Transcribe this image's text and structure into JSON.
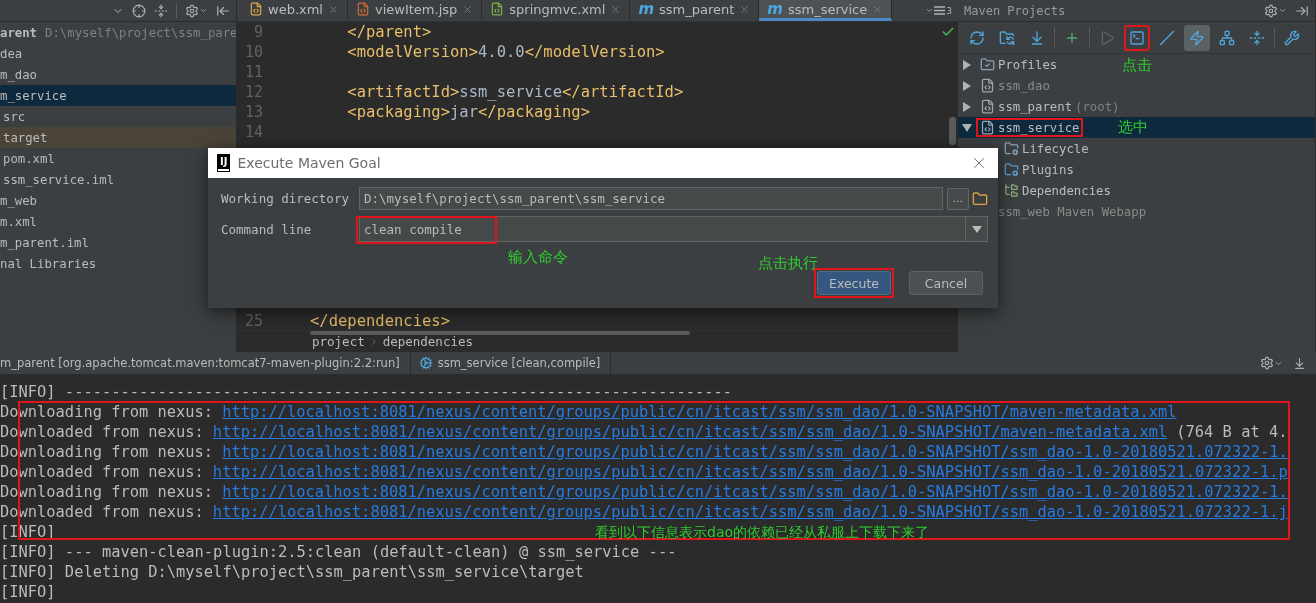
{
  "project_panel": {
    "rows": [
      {
        "label": "arent",
        "detail": "D:\\myself\\project\\ssm_pare",
        "selected": false,
        "excluded": false
      },
      {
        "label": "dea",
        "selected": false,
        "excluded": false
      },
      {
        "label": "m_dao",
        "selected": false,
        "excluded": false
      },
      {
        "label": "m_service",
        "selected": true,
        "excluded": false,
        "children": [
          {
            "label": "src",
            "selected": false,
            "excluded": false
          },
          {
            "label": "target",
            "selected": false,
            "excluded": true
          },
          {
            "label": "pom.xml",
            "selected": false,
            "excluded": false
          },
          {
            "label": "ssm_service.iml",
            "selected": false,
            "excluded": false
          }
        ]
      },
      {
        "label": "m_web",
        "selected": false,
        "excluded": false
      },
      {
        "label": "m.xml",
        "selected": false,
        "excluded": false
      },
      {
        "label": "m_parent.iml",
        "selected": false,
        "excluded": false
      },
      {
        "label": "nal Libraries",
        "selected": false,
        "excluded": false
      }
    ]
  },
  "editor": {
    "tabs": [
      {
        "label": "web.xml",
        "kind": "xml",
        "selected": false
      },
      {
        "label": "viewItem.jsp",
        "kind": "jsp",
        "selected": false
      },
      {
        "label": "springmvc.xml",
        "kind": "spring",
        "selected": false
      },
      {
        "label": "ssm_parent",
        "kind": "maven",
        "glyph": "m",
        "selected": false
      },
      {
        "label": "ssm_service",
        "kind": "maven",
        "glyph": "m",
        "selected": true
      }
    ],
    "overflow_count": "3",
    "lines": [
      {
        "number": "9",
        "tokens": [
          {
            "kind": "tag",
            "text": "    </parent>"
          }
        ]
      },
      {
        "number": "10",
        "tokens": [
          {
            "kind": "tag",
            "text": "    <modelVersion>"
          },
          {
            "kind": "text",
            "text": "4.0.0"
          },
          {
            "kind": "tag",
            "text": "</modelVersion>"
          }
        ]
      },
      {
        "number": "11"
      },
      {
        "number": "12",
        "tokens": [
          {
            "kind": "tag",
            "text": "    <artifactId>"
          },
          {
            "kind": "text",
            "text": "ssm_service"
          },
          {
            "kind": "tag",
            "text": "</artifactId>"
          }
        ]
      },
      {
        "number": "13",
        "tokens": [
          {
            "kind": "tag",
            "text": "    <packaging>"
          },
          {
            "kind": "text",
            "text": "jar"
          },
          {
            "kind": "tag",
            "text": "</packaging>"
          }
        ]
      },
      {
        "number": "14"
      },
      {
        "number": "25",
        "tokens": [
          {
            "kind": "tag",
            "text": "</dependencies>"
          }
        ]
      }
    ],
    "breadcrumbs": [
      "project",
      "dependencies"
    ]
  },
  "maven_panel": {
    "title": "Maven Projects",
    "toolbar": [
      {
        "kind": "reimport",
        "selected": false,
        "outlined": false,
        "disabled": false
      },
      {
        "kind": "generate",
        "selected": false,
        "outlined": false,
        "disabled": false
      },
      {
        "kind": "download",
        "selected": false,
        "outlined": false,
        "disabled": false
      },
      {
        "kind": "add",
        "selected": false,
        "outlined": false,
        "disabled": false
      },
      {
        "kind": "run",
        "selected": false,
        "outlined": false,
        "disabled": true
      },
      {
        "kind": "execute",
        "selected": false,
        "outlined": true,
        "disabled": false
      },
      {
        "kind": "skip",
        "selected": false,
        "outlined": false,
        "disabled": false
      },
      {
        "kind": "offline",
        "selected": true,
        "outlined": false,
        "disabled": false
      },
      {
        "kind": "dependencies",
        "selected": false,
        "outlined": false,
        "disabled": false
      },
      {
        "kind": "collapse",
        "selected": false,
        "outlined": false,
        "disabled": false
      },
      {
        "kind": "settings",
        "selected": false,
        "outlined": false,
        "disabled": false
      }
    ],
    "tree": [
      {
        "label": "Profiles",
        "kind": "profiles",
        "expanded": false,
        "selected": false,
        "ignored": false,
        "outlined": false,
        "note": "点击"
      },
      {
        "label": "ssm_dao",
        "kind": "module",
        "expanded": false,
        "selected": false,
        "ignored": true,
        "outlined": false
      },
      {
        "label": "ssm_parent",
        "detail": "(root)",
        "kind": "module",
        "expanded": false,
        "selected": false,
        "ignored": false,
        "outlined": false
      },
      {
        "label": "ssm_service",
        "kind": "module",
        "expanded": true,
        "selected": true,
        "ignored": false,
        "outlined": true,
        "note": "选中",
        "children": [
          {
            "label": "Lifecycle",
            "kind": "lifecycle",
            "selected": false,
            "ignored": false,
            "outlined": false
          },
          {
            "label": "Plugins",
            "kind": "plugins",
            "selected": false,
            "ignored": false,
            "outlined": false
          },
          {
            "label": "Dependencies",
            "kind": "dependencies",
            "selected": false,
            "ignored": false,
            "outlined": false
          }
        ]
      },
      {
        "label": "ssm_web Maven Webapp",
        "kind": "covered",
        "selected": false,
        "ignored": true,
        "outlined": false
      }
    ]
  },
  "dialog": {
    "logo": "IJ",
    "title": "Execute Maven Goal",
    "working_directory": {
      "label": "Working directory",
      "value": "D:\\myself\\project\\ssm_parent\\ssm_service",
      "browse": "..."
    },
    "command_line": {
      "label": "Command line",
      "value": "clean compile",
      "outlined": true
    },
    "annotations": [
      "输入命令",
      "点击执行"
    ],
    "buttons": [
      {
        "label": "Execute",
        "default": true,
        "outlined": true
      },
      {
        "label": "Cancel",
        "default": false,
        "outlined": false
      }
    ]
  },
  "run_panel": {
    "tabs": [
      {
        "label": "m_parent [org.apache.tomcat.maven:tomcat7-maven-plugin:2.2:run]",
        "kind": "plain"
      },
      {
        "label": "ssm_service [clean,compile]",
        "kind": "maven-goal"
      }
    ],
    "console": {
      "outlined": true,
      "note": "看到以下信息表示dao的依赖已经从私服上下载下来了",
      "lines": [
        {
          "kind": "plain",
          "text": "[INFO] ------------------------------------------------------------------------"
        },
        {
          "kind": "download",
          "prefix": "Downloading from nexus:",
          "link": "http://localhost:8081/nexus/content/groups/public/cn/itcast/ssm/ssm_dao/1.0-SNAPSHOT/maven-metadata.xml"
        },
        {
          "kind": "download",
          "prefix": "Downloaded from nexus:",
          "link": "http://localhost:8081/nexus/content/groups/public/cn/itcast/ssm/ssm_dao/1.0-SNAPSHOT/maven-metadata.xml",
          "suffix": "(764 B at 4."
        },
        {
          "kind": "download",
          "prefix": "Downloading from nexus:",
          "link": "http://localhost:8081/nexus/content/groups/public/cn/itcast/ssm/ssm_dao/1.0-SNAPSHOT/ssm_dao-1.0-20180521.072322-1."
        },
        {
          "kind": "download",
          "prefix": "Downloaded from nexus:",
          "link": "http://localhost:8081/nexus/content/groups/public/cn/itcast/ssm/ssm_dao/1.0-SNAPSHOT/ssm_dao-1.0-20180521.072322-1.p"
        },
        {
          "kind": "download",
          "prefix": "Downloading from nexus:",
          "link": "http://localhost:8081/nexus/content/groups/public/cn/itcast/ssm/ssm_dao/1.0-SNAPSHOT/ssm_dao-1.0-20180521.072322-1."
        },
        {
          "kind": "download",
          "prefix": "Downloaded from nexus:",
          "link": "http://localhost:8081/nexus/content/groups/public/cn/itcast/ssm/ssm_dao/1.0-SNAPSHOT/ssm_dao-1.0-20180521.072322-1.j"
        },
        {
          "kind": "plain",
          "text": "[INFO]"
        },
        {
          "kind": "plain",
          "text": "[INFO] --- maven-clean-plugin:2.5:clean (default-clean) @ ssm_service ---"
        },
        {
          "kind": "plain",
          "text": "[INFO] Deleting D:\\myself\\project\\ssm_parent\\ssm_service\\target"
        },
        {
          "kind": "plain",
          "text": "[INFO]"
        }
      ]
    }
  }
}
